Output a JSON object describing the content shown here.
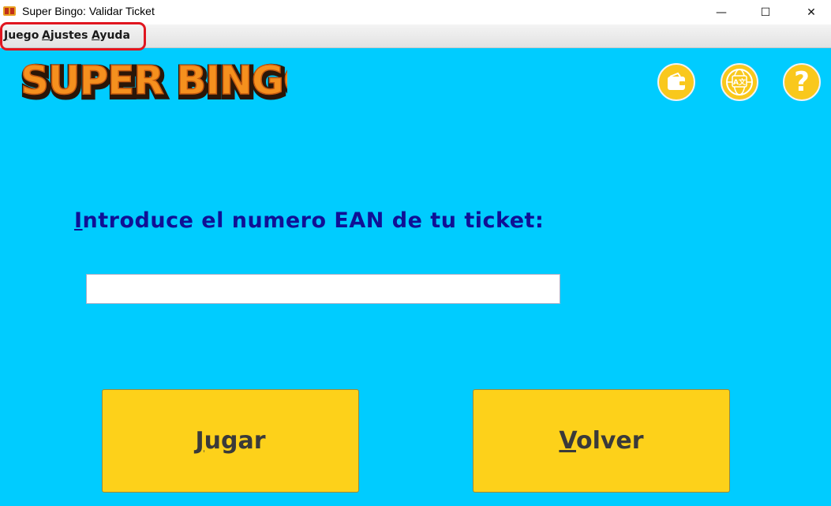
{
  "window": {
    "title": "Super Bingo: Validar Ticket",
    "minimize_glyph": "—",
    "maximize_glyph": "☐",
    "close_glyph": "✕"
  },
  "menu": {
    "items": [
      {
        "mnemonic": "J",
        "rest": "uego"
      },
      {
        "mnemonic": "A",
        "rest": "justes"
      },
      {
        "mnemonic": "A",
        "rest": "yuda"
      }
    ],
    "highlight_color": "#e0161f"
  },
  "logo": {
    "text": "SUPER BINGO"
  },
  "toolbar": {
    "icons": [
      "wallet-icon",
      "globe-translate-icon",
      "help-icon"
    ],
    "help_glyph": "?"
  },
  "form": {
    "prompt_mnemonic": "I",
    "prompt_rest": "ntroduce el numero EAN de tu ticket:",
    "ean_value": ""
  },
  "buttons": {
    "play": {
      "mnemonic": "J",
      "rest": "ugar"
    },
    "back": {
      "mnemonic": "V",
      "rest": "olver"
    }
  },
  "colors": {
    "background": "#00ccff",
    "button": "#fdd11a",
    "prompt_text": "#101095",
    "logo_orange": "#f5901e"
  }
}
